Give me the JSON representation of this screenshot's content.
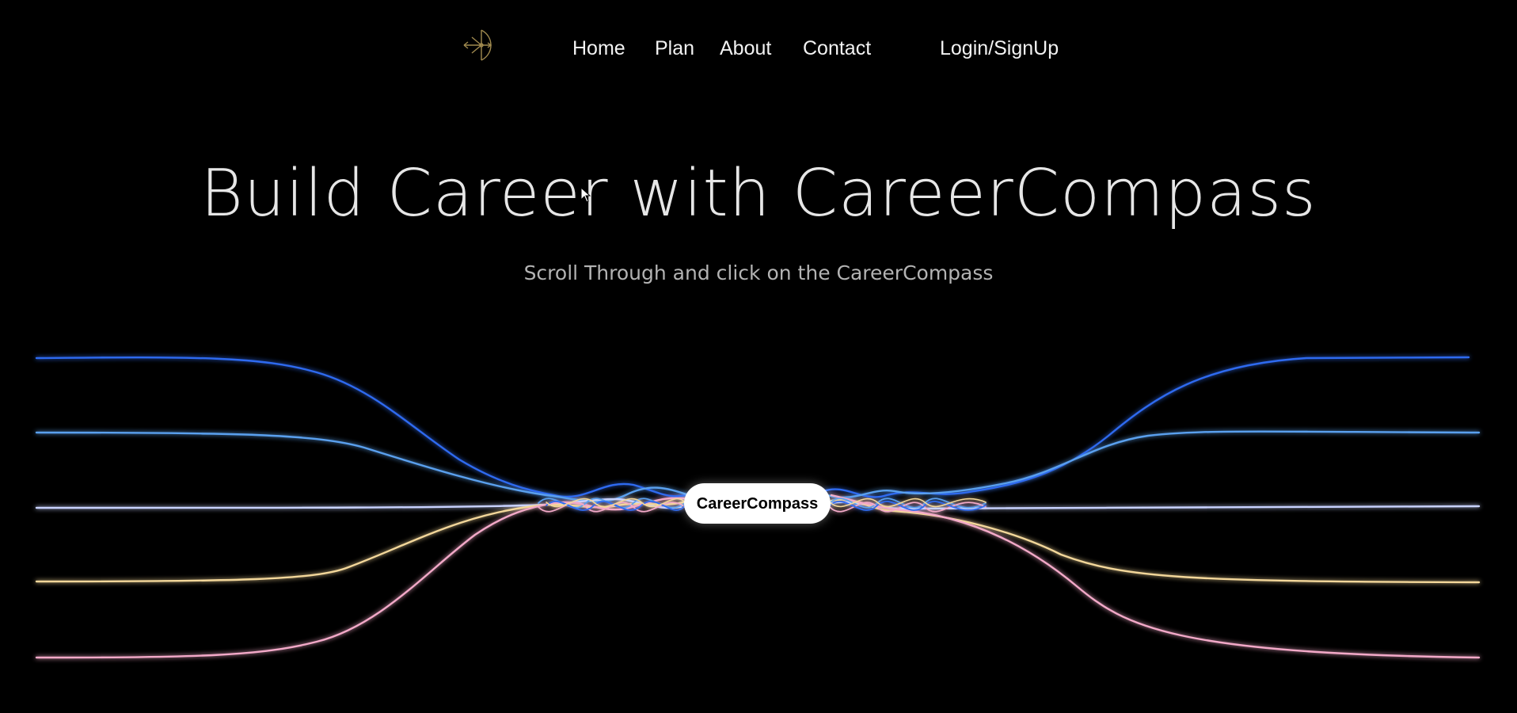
{
  "nav": {
    "logo_icon": "compass-archer-logo",
    "items": [
      {
        "label": "Home"
      },
      {
        "label": "Plan"
      },
      {
        "label": "About"
      },
      {
        "label": "Contact"
      }
    ],
    "login_label": "Login/SignUp"
  },
  "hero": {
    "title": "Build Career with CareerCompass",
    "subtitle": "Scroll Through and click on the CareerCompass"
  },
  "center_button": {
    "label": "CareerCompass"
  },
  "colors": {
    "background": "#000000",
    "wave_blue_dark": "#2f6bf0",
    "wave_blue_mid": "#5aa0ee",
    "wave_lavender": "#c8d2ff",
    "wave_yellow": "#f3d79a",
    "wave_pink": "#f3a9c8",
    "logo_gold": "#a08a4f"
  }
}
